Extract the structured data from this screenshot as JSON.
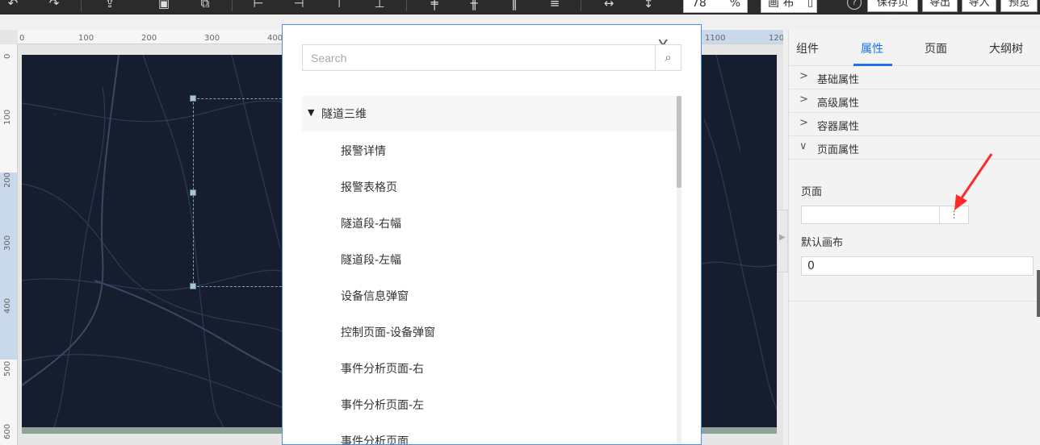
{
  "toolbar": {
    "zoom_value": "78",
    "zoom_unit": "%",
    "canvas_label": "画 布",
    "help_glyph": "?",
    "save_label": "保存页面",
    "export_label": "导出",
    "import_label": "导入",
    "preview_label": "预览"
  },
  "ruler": {
    "top_ticks": [
      "0",
      "100",
      "200",
      "300",
      "400",
      "1100",
      "120"
    ],
    "left_ticks": [
      "0",
      "100",
      "200",
      "300",
      "400",
      "500",
      "600"
    ]
  },
  "modal": {
    "search_placeholder": "Search",
    "close_glyph": "X",
    "tree": {
      "root_label": "隧道三维",
      "items": [
        "报警详情",
        "报警表格页",
        "隧道段-右幅",
        "隧道段-左幅",
        "设备信息弹窗",
        "控制页面-设备弹窗",
        "事件分析页面-右",
        "事件分析页面-左",
        "事件分析页面"
      ]
    }
  },
  "panel": {
    "tabs": [
      "组件",
      "属性",
      "页面",
      "大纲树"
    ],
    "active_tab": "属性",
    "sections": [
      {
        "label": "基础属性",
        "expanded": false
      },
      {
        "label": "高级属性",
        "expanded": false
      },
      {
        "label": "容器属性",
        "expanded": false
      },
      {
        "label": "页面属性",
        "expanded": true
      }
    ],
    "page_label": "页面",
    "page_value": "",
    "more_glyph": "⋮",
    "default_canvas_label": "默认画布",
    "default_canvas_value": "0"
  },
  "annotation": {
    "color": "#ff2a2a"
  },
  "colors": {
    "accent": "#1a73e8",
    "map_bg": "#161d2e",
    "toolbar_bg": "#2b2b2b"
  }
}
